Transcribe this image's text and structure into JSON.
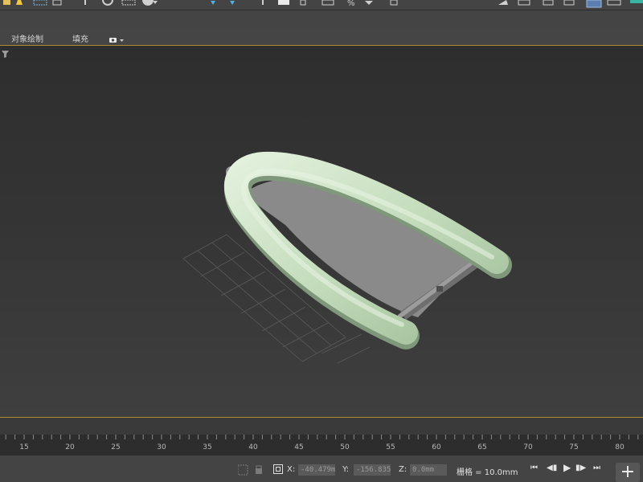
{
  "ribbon": {
    "tabs": [
      "对象绘制",
      "填充"
    ]
  },
  "timeline": {
    "frames": [
      "15",
      "20",
      "25",
      "30",
      "35",
      "40",
      "45",
      "50",
      "55",
      "60",
      "65",
      "70",
      "75",
      "80"
    ]
  },
  "status": {
    "x_label": "X:",
    "x_value": "-40.479m",
    "y_label": "Y:",
    "y_value": "-156.835",
    "z_label": "Z:",
    "z_value": "0.0mm",
    "grid": "栅格 = 10.0mm"
  },
  "playback": {
    "first": "⏮",
    "prev": "◀▮",
    "play": "▶",
    "next": "▮▶",
    "last": "⏭"
  },
  "add_label": "+",
  "colors": {
    "tube": "#c4dcbc",
    "surface": "#8a8a8a",
    "accent_line": "#b08a2e",
    "active_button": "#5b7fae"
  },
  "icons": [
    "select-icon",
    "move-icon",
    "rotate-icon",
    "scale-icon",
    "snap-icon",
    "percent-snap-icon",
    "filter-icon",
    "key-icon",
    "lock-icon",
    "absolute-mode-icon"
  ]
}
